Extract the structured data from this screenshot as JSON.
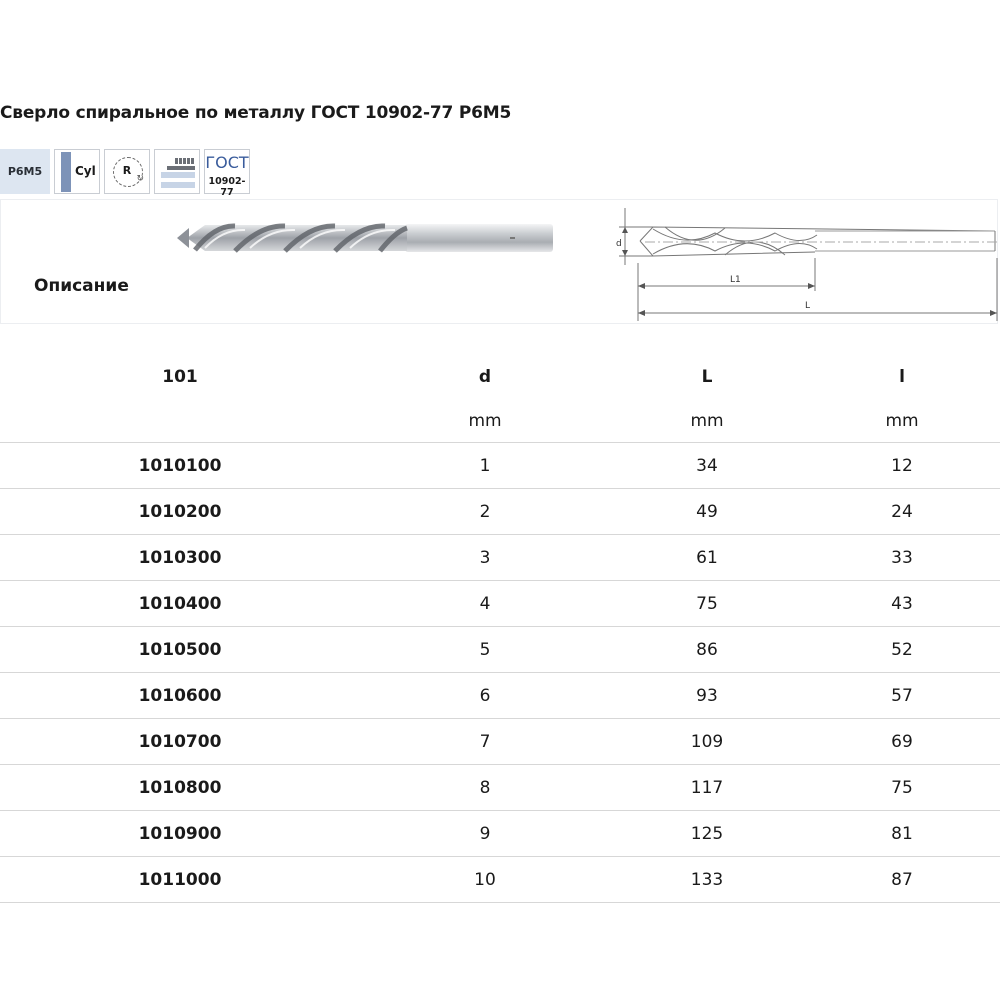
{
  "title": "Сверло спиральное по металлу ГОСТ 10902-77 Р6М5",
  "badges": {
    "steel": "P6M5",
    "shank": "Cyl",
    "rotation": "R",
    "gost_top": "ГОСТ",
    "gost_bottom": "10902-77"
  },
  "description_label": "Описание",
  "schema_labels": {
    "d": "d",
    "l1": "L1",
    "l": "L"
  },
  "table": {
    "headers": [
      "101",
      "d",
      "L",
      "l"
    ],
    "units": [
      "",
      "mm",
      "mm",
      "mm"
    ],
    "rows": [
      [
        "1010100",
        "1",
        "34",
        "12"
      ],
      [
        "1010200",
        "2",
        "49",
        "24"
      ],
      [
        "1010300",
        "3",
        "61",
        "33"
      ],
      [
        "1010400",
        "4",
        "75",
        "43"
      ],
      [
        "1010500",
        "5",
        "86",
        "52"
      ],
      [
        "1010600",
        "6",
        "93",
        "57"
      ],
      [
        "1010700",
        "7",
        "109",
        "69"
      ],
      [
        "1010800",
        "8",
        "117",
        "75"
      ],
      [
        "1010900",
        "9",
        "125",
        "81"
      ],
      [
        "1011000",
        "10",
        "133",
        "87"
      ]
    ]
  }
}
